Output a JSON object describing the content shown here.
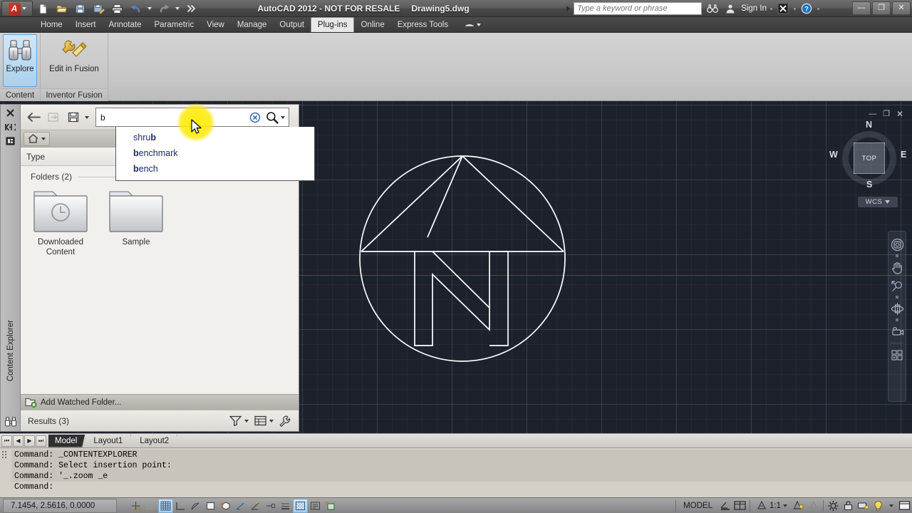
{
  "titlebar": {
    "app_title": "AutoCAD 2012 - NOT FOR RESALE",
    "document_name": "Drawing5.dwg",
    "quick_access": [
      {
        "name": "new-icon",
        "label": "New"
      },
      {
        "name": "open-icon",
        "label": "Open"
      },
      {
        "name": "save-icon",
        "label": "Save"
      },
      {
        "name": "saveas-icon",
        "label": "Save As"
      },
      {
        "name": "plot-icon",
        "label": "Plot"
      },
      {
        "name": "undo-icon",
        "label": "Undo"
      },
      {
        "name": "redo-icon",
        "label": "Redo"
      },
      {
        "name": "qat-more-icon",
        "label": "More"
      }
    ],
    "infocenter": {
      "placeholder": "Type a keyword or phrase",
      "value": "",
      "signin_label": "Sign In",
      "exchange_label": "X",
      "help_label": "?"
    },
    "window_controls": {
      "minimize": "—",
      "restore": "❐",
      "close": "✕"
    }
  },
  "ribbon": {
    "tabs": [
      {
        "label": "Home",
        "active": false
      },
      {
        "label": "Insert",
        "active": false
      },
      {
        "label": "Annotate",
        "active": false
      },
      {
        "label": "Parametric",
        "active": false
      },
      {
        "label": "View",
        "active": false
      },
      {
        "label": "Manage",
        "active": false
      },
      {
        "label": "Output",
        "active": false
      },
      {
        "label": "Plug-ins",
        "active": true
      },
      {
        "label": "Online",
        "active": false
      },
      {
        "label": "Express Tools",
        "active": false
      }
    ],
    "panels": [
      {
        "title": "Content",
        "buttons": [
          {
            "label": "Explore",
            "icon": "binoculars-icon",
            "selected": true
          }
        ]
      },
      {
        "title": "Inventor Fusion",
        "buttons": [
          {
            "label": "Edit in Fusion",
            "icon": "fusion-wrench-icon",
            "selected": false
          }
        ]
      }
    ]
  },
  "content_explorer": {
    "dock_title": "Content Explorer",
    "dock_icons": [
      {
        "name": "close-icon",
        "glyph": "✕"
      },
      {
        "name": "auto-hide-icon",
        "glyph": "◀▶"
      },
      {
        "name": "panel-properties-icon",
        "glyph": "▣"
      },
      {
        "name": "binoculars-icon",
        "glyph": ""
      }
    ],
    "toolbar": {
      "back_label": "Back",
      "forward_label": "Forward",
      "save_label": "Save",
      "search_value": "b",
      "search_placeholder": "",
      "clear_label": "Clear search",
      "search_label": "Search"
    },
    "autocomplete": {
      "visible": true,
      "items": [
        {
          "prefix": "shru",
          "match": "b",
          "suffix": ""
        },
        {
          "prefix": "",
          "match": "b",
          "suffix": "enchmark"
        },
        {
          "prefix": "",
          "match": "b",
          "suffix": "ench"
        }
      ]
    },
    "breadcrumb": {
      "home_label": "Home"
    },
    "column_header": "Type",
    "folders_section": {
      "title": "Folders (2)",
      "collapse_label": "Collapse",
      "items": [
        {
          "name": "Downloaded Content",
          "icon": "folder-clock-icon"
        },
        {
          "name": "Sample",
          "icon": "folder-icon"
        }
      ]
    },
    "add_watched_folder": "Add Watched Folder...",
    "status": {
      "results_label": "Results (3)",
      "filter_label": "Filter",
      "view_label": "View options",
      "settings_label": "Configure"
    }
  },
  "viewport": {
    "viewcube": {
      "face": "TOP",
      "north": "N",
      "south": "S",
      "east": "E",
      "west": "W",
      "wcs_label": "WCS"
    },
    "window_controls": {
      "minimize": "—",
      "restore": "❐",
      "close": "✕"
    },
    "navbar": [
      {
        "name": "steering-wheel-icon",
        "label": "Full Navigation Wheel"
      },
      {
        "name": "pan-hand-icon",
        "label": "Pan"
      },
      {
        "name": "zoom-extents-icon",
        "label": "Zoom Extents"
      },
      {
        "name": "orbit-icon",
        "label": "Orbit"
      },
      {
        "name": "showmotion-camera-icon",
        "label": "ShowMotion"
      },
      {
        "name": "showmotion-grid-icon",
        "label": "ShowMotion Shots"
      }
    ],
    "drawing_name": "north-arrow-block"
  },
  "layout_tabs": {
    "nav_buttons": [
      "⏮",
      "◀",
      "▶",
      "⏭"
    ],
    "tabs": [
      {
        "label": "Model",
        "active": true
      },
      {
        "label": "Layout1",
        "active": false
      },
      {
        "label": "Layout2",
        "active": false
      }
    ]
  },
  "command_line": {
    "history": [
      "Command: _CONTENTEXPLORER",
      "Command: Select insertion point:",
      "Command: '_.zoom _e"
    ],
    "prompt": "Command:"
  },
  "status_bar": {
    "coordinates": "7.1454, 2.5616, 0.0000",
    "left_toggles": [
      {
        "name": "infer-constraints-icon",
        "on": false
      },
      {
        "name": "snap-mode-icon",
        "on": false
      },
      {
        "name": "grid-display-icon",
        "on": true
      },
      {
        "name": "ortho-mode-icon",
        "on": false
      },
      {
        "name": "polar-tracking-icon",
        "on": false
      },
      {
        "name": "object-snap-icon",
        "on": false
      },
      {
        "name": "3d-object-snap-icon",
        "on": false
      },
      {
        "name": "object-snap-tracking-icon",
        "on": false
      },
      {
        "name": "dynamic-ucs-icon",
        "on": false
      },
      {
        "name": "dynamic-input-icon",
        "on": false
      },
      {
        "name": "lineweight-icon",
        "on": false
      },
      {
        "name": "transparency-icon",
        "on": true
      },
      {
        "name": "quick-properties-icon",
        "on": false
      },
      {
        "name": "selection-cycling-icon",
        "on": false
      }
    ],
    "model_label": "MODEL",
    "space_toggles": [
      {
        "name": "model-space-icon"
      },
      {
        "name": "layout-space-icon"
      }
    ],
    "annotation_scale": "1:1",
    "right_toggles": [
      {
        "name": "annotation-visibility-icon"
      },
      {
        "name": "auto-scale-icon"
      },
      {
        "name": "workspace-gear-icon"
      },
      {
        "name": "toolbar-lock-icon"
      },
      {
        "name": "hardware-accel-icon"
      },
      {
        "name": "isolate-objects-bulb-icon"
      },
      {
        "name": "clean-screen-icon"
      }
    ]
  },
  "colors": {
    "canvas_bg": "#1c212b",
    "geometry_stroke": "#ffffff",
    "x_axis": "#77393c",
    "accent_blue": "#1b2a6b",
    "highlight_yellow": "#ffeb00",
    "ribbon_selected": "#a9d0ee"
  }
}
